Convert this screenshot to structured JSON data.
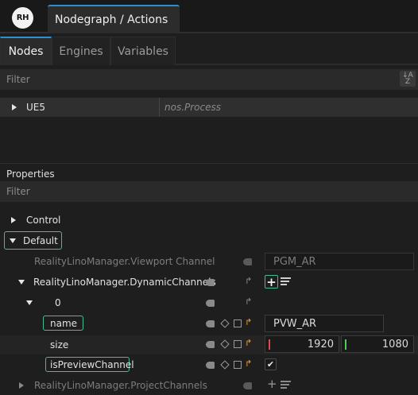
{
  "app": {
    "logo_text": "RH",
    "title": "Nodegraph / Actions"
  },
  "tabs": [
    {
      "label": "Nodes",
      "active": true
    },
    {
      "label": "Engines",
      "active": false
    },
    {
      "label": "Variables",
      "active": false
    }
  ],
  "nodes_filter": {
    "placeholder": "Filter",
    "sort_icon": "sort-az-icon"
  },
  "node_list": [
    {
      "name": "UE5",
      "type": "nos.Process"
    }
  ],
  "properties": {
    "header": "Properties",
    "filter_placeholder": "Filter",
    "sections": {
      "control": "Control",
      "default": "Default"
    },
    "viewport_channel": {
      "label": "RealityLinoManager.Viewport Channel",
      "value": "PGM_AR"
    },
    "dynamic_channels": {
      "label": "RealityLinoManager.DynamicChannels",
      "add_symbol": "+",
      "item_index": "0"
    },
    "name_field": {
      "label": "name",
      "value": "PVW_AR"
    },
    "size_field": {
      "label": "size",
      "x": "1920",
      "y": "1080"
    },
    "preview_field": {
      "label": "isPreviewChannel",
      "checked": true,
      "check_glyph": "✔"
    },
    "project_channels": {
      "label": "RealityLinoManager.ProjectChannels",
      "add_symbol": "+"
    }
  },
  "colors": {
    "accent_blue": "#2d8fd0",
    "highlight_green": "#3fbf98",
    "pin_orange": "#e8a13a",
    "axis_x": "#e04a4a",
    "axis_y": "#4ccf4c"
  }
}
